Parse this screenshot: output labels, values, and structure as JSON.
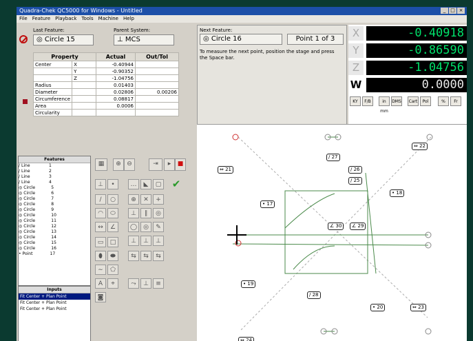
{
  "window": {
    "title": "Quadra-Chek QC5000 for Windows - Untitled"
  },
  "menu": [
    "File",
    "Feature",
    "Playback",
    "Tools",
    "Machine",
    "Help"
  ],
  "last_feature": {
    "label": "Last Feature:",
    "value": "Circle 15"
  },
  "parent_system": {
    "label": "Parent System:",
    "value": "MCS"
  },
  "properties": {
    "headers": [
      "Property",
      "Actual",
      "Out/Tol"
    ],
    "rows": [
      {
        "name": "Center",
        "axis": "X",
        "actual": "-0.40944",
        "tol": ""
      },
      {
        "name": "",
        "axis": "Y",
        "actual": "-0.90352",
        "tol": ""
      },
      {
        "name": "",
        "axis": "Z",
        "actual": "-1.04756",
        "tol": ""
      },
      {
        "name": "Radius",
        "axis": "",
        "actual": "0.01403",
        "tol": ""
      },
      {
        "name": "Diameter",
        "axis": "",
        "actual": "0.02806",
        "tol": "0.00206"
      },
      {
        "name": "Circumference",
        "axis": "",
        "actual": "0.08817",
        "tol": ""
      },
      {
        "name": "Area",
        "axis": "",
        "actual": "0.0006",
        "tol": ""
      },
      {
        "name": "Circularity",
        "axis": "",
        "actual": "",
        "tol": ""
      }
    ]
  },
  "next_feature": {
    "label": "Next Feature:",
    "value": "Circle 16",
    "point": "Point 1 of 3",
    "instructions": "To measure the next point, position the stage and press the Space bar."
  },
  "dro": {
    "axes": [
      {
        "axis": "X",
        "value": "-0.40918"
      },
      {
        "axis": "Y",
        "value": "-0.86590"
      },
      {
        "axis": "Z",
        "value": "-1.04756"
      },
      {
        "axis": "W",
        "value": "0.0000"
      }
    ],
    "buttons": [
      "KY",
      "F/B",
      "in mm",
      "DMS",
      "Cart",
      "Pol",
      "%",
      "Fr"
    ]
  },
  "features": {
    "title": "Features",
    "rows": [
      {
        "type": "Line",
        "n": "1"
      },
      {
        "type": "Line",
        "n": "2"
      },
      {
        "type": "Line",
        "n": "3"
      },
      {
        "type": "Line",
        "n": "4"
      },
      {
        "type": "Circle",
        "n": "5"
      },
      {
        "type": "Circle",
        "n": "6"
      },
      {
        "type": "Circle",
        "n": "7"
      },
      {
        "type": "Circle",
        "n": "8"
      },
      {
        "type": "Circle",
        "n": "9"
      },
      {
        "type": "Circle",
        "n": "10"
      },
      {
        "type": "Circle",
        "n": "11"
      },
      {
        "type": "Circle",
        "n": "12"
      },
      {
        "type": "Circle",
        "n": "13"
      },
      {
        "type": "Circle",
        "n": "14"
      },
      {
        "type": "Circle",
        "n": "15"
      },
      {
        "type": "Circle",
        "n": "16"
      },
      {
        "type": "Point",
        "n": "17"
      }
    ]
  },
  "inputs": {
    "title": "Inputs",
    "rows": [
      "Fit Center  + Plan Point",
      "Fit Center  + Plan Point",
      "Fit Center  + Plan Point"
    ]
  },
  "canvas_labels": [
    "21",
    "27",
    "22",
    "26",
    "25",
    "18",
    "17",
    "30",
    "29",
    "19",
    "28",
    "20",
    "23",
    "24"
  ]
}
